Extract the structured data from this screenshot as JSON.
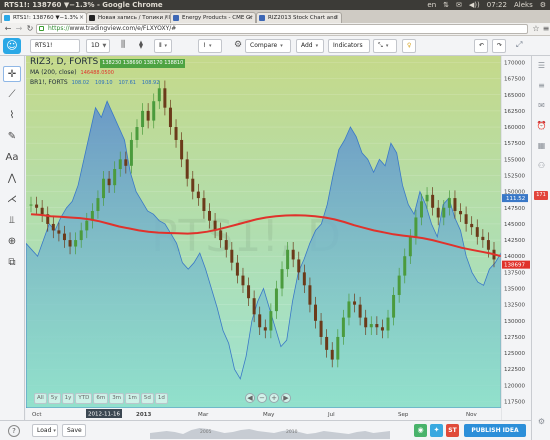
{
  "os": {
    "window_title": "RTS1!: 138760 ▼−1.3% - Google Chrome",
    "tray": [
      "en",
      "⇅",
      "✉",
      "◀))",
      "07:22",
      "Aleks",
      "⚙"
    ]
  },
  "browser": {
    "tabs": [
      {
        "title": "RTS1!: 138760 ▼−1.3%",
        "fav_color": "#2aa8e6",
        "active": true
      },
      {
        "title": "Новая запись / Топики / I",
        "fav_color": "#222222",
        "active": false
      },
      {
        "title": "Energy Products - CME Gr",
        "fav_color": "#3d67b5",
        "active": false
      },
      {
        "title": "RIZ2013 Stock Chart and",
        "fav_color": "#3d67b5",
        "active": false
      }
    ],
    "url_scheme": "https://",
    "url_rest": "www.tradingview.com/e/FLXYOXY/#"
  },
  "toolbar": {
    "symbol": "RTS1!",
    "interval": "1D",
    "compare_label": "Compare",
    "add_label": "Add",
    "indicators_label": "Indicators"
  },
  "left_tools": [
    {
      "name": "crosshair-icon",
      "glyph": "✛"
    },
    {
      "name": "trend-line-icon",
      "glyph": "⟋"
    },
    {
      "name": "fib-icon",
      "glyph": "⌇"
    },
    {
      "name": "brush-icon",
      "glyph": "✎"
    },
    {
      "name": "text-icon",
      "glyph": "Aa"
    },
    {
      "name": "pattern-icon",
      "glyph": "⋀"
    },
    {
      "name": "prediction-icon",
      "glyph": "⋌"
    },
    {
      "name": "measure-icon",
      "glyph": "⫫"
    },
    {
      "name": "zoom-icon",
      "glyph": "⊕"
    },
    {
      "name": "stack-icon",
      "glyph": "⧉"
    }
  ],
  "legend": {
    "title": "RIZ3, D, FORTS",
    "ohlc": "138230 138690 138170 138810",
    "ma_label": "MA (200, close)",
    "ma_value": "146488.0500",
    "br_label": "BR1!, FORTS",
    "br_values": [
      "108.02",
      "109.10",
      "107.61",
      "108.92"
    ]
  },
  "watermark": "RTS1!, D",
  "chart_data": {
    "type": "line",
    "price_axis": [
      "170000",
      "167500",
      "165000",
      "162500",
      "160000",
      "157500",
      "155000",
      "152500",
      "150000",
      "147500",
      "145000",
      "142500",
      "140000",
      "137500",
      "135000",
      "132500",
      "130000",
      "127500",
      "125000",
      "122500",
      "120000",
      "117500"
    ],
    "time_axis": [
      "Oct",
      "2012-11-16",
      "2013",
      "Mar",
      "May",
      "Jul",
      "Sep",
      "Nov"
    ],
    "ylim": [
      116500,
      171000
    ],
    "last_price": "138697",
    "br_last": "111.52",
    "br_price": [
      142000,
      141000,
      140000,
      142500,
      145000,
      144000,
      146000,
      147500,
      148500,
      151000,
      155000,
      159000,
      163000,
      161500,
      164000,
      162000,
      160000,
      158000,
      153000,
      150000,
      148500,
      147000,
      146500,
      145500,
      145000,
      143500,
      142000,
      139000,
      138000,
      139000,
      140500,
      138000,
      135000,
      132000,
      128500,
      126500,
      122500,
      121000,
      124500,
      130000,
      133000,
      135000,
      132000,
      129000,
      126000,
      127000,
      133000,
      137500,
      139500,
      142000,
      144000,
      145000,
      148000,
      152500,
      156500,
      158000,
      160000,
      158500,
      156000,
      155000,
      153000,
      155000,
      154000,
      157500,
      156000,
      151000,
      148000,
      146500,
      150000,
      148000,
      145000,
      143000,
      148000,
      149000,
      146000,
      144000,
      140000,
      137500,
      136000,
      135500,
      138000,
      139000,
      140500
    ],
    "candles": [
      148000,
      147500,
      146500,
      145000,
      144000,
      143500,
      142500,
      141500,
      142500,
      144000,
      145500,
      147000,
      149000,
      152000,
      151000,
      153500,
      155000,
      154000,
      158000,
      160000,
      162500,
      161000,
      164000,
      166000,
      163000,
      160000,
      158000,
      155000,
      152000,
      150000,
      149000,
      147000,
      145500,
      144000,
      142500,
      141000,
      139000,
      137000,
      135500,
      133500,
      131000,
      129000,
      128500,
      131500,
      135000,
      138000,
      141000,
      139500,
      137500,
      135500,
      132500,
      130000,
      127500,
      125500,
      124000,
      127500,
      130500,
      133000,
      132500,
      130500,
      129000,
      129500,
      129000,
      128500,
      130500,
      134000,
      137000,
      140000,
      143000,
      146000,
      148500,
      149500,
      147500,
      146000,
      147500,
      149000,
      147000,
      146500,
      145000,
      144500,
      143000,
      142500,
      141000,
      139500
    ],
    "ma200": [
      146500,
      146400,
      146200,
      146100,
      146000,
      145900,
      145700,
      145400,
      145000,
      144600,
      144300,
      144000,
      143800,
      143650,
      143600,
      143550,
      143500,
      143600,
      143800,
      144100,
      144500,
      144900,
      145300,
      145700,
      146000,
      146200,
      146300,
      146350,
      146300,
      146200,
      146000,
      145700,
      145300,
      144800,
      144400,
      144000,
      143700,
      143400,
      143200,
      143000,
      142800,
      142500,
      142100,
      141700,
      141300,
      141000,
      140700,
      140400,
      140000
    ],
    "ma_last": "138887"
  },
  "timeframes": [
    "All",
    "5y",
    "1y",
    "YTD",
    "6m",
    "3m",
    "1m",
    "5d",
    "1d"
  ],
  "bottom": {
    "load_label": "Load",
    "save_label": "Save",
    "publish_label": "PUBLISH IDEA",
    "mini_years": [
      "2005",
      "2010"
    ]
  },
  "colors": {
    "area_top": "#5c8ed0",
    "area_bottom": "#8de0c8",
    "bg_top": "#c5d98a",
    "bg_bottom": "#9de3d4",
    "ma": "#e0322b",
    "up": "#4b9b3d",
    "down": "#6b3a1a",
    "accent": "#2aa8e6"
  }
}
